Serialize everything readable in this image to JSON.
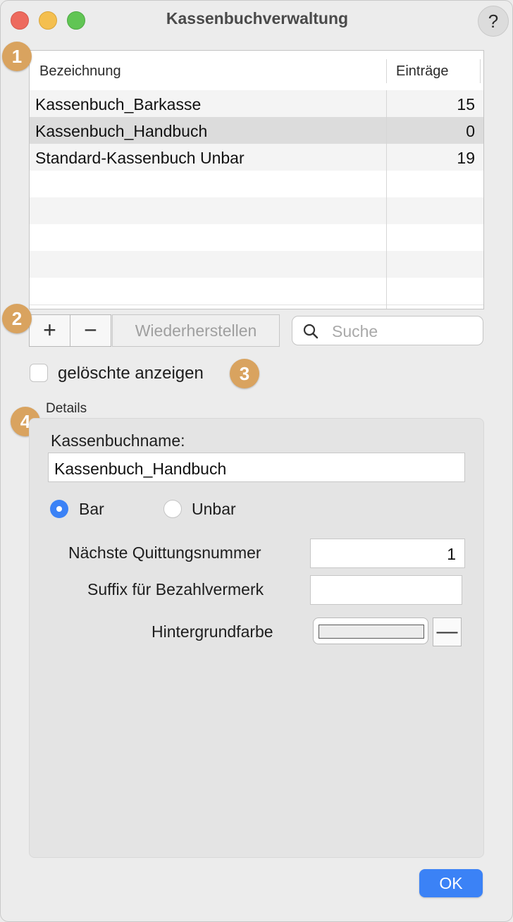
{
  "window": {
    "title": "Kassenbuchverwaltung",
    "help_label": "?"
  },
  "badges": [
    "1",
    "2",
    "3",
    "4"
  ],
  "table": {
    "columns": [
      "Bezeichnung",
      "Einträge"
    ],
    "rows": [
      {
        "name": "Kassenbuch_Barkasse",
        "count": "15",
        "selected": false
      },
      {
        "name": "Kassenbuch_Handbuch",
        "count": "0",
        "selected": true
      },
      {
        "name": "Standard-Kassenbuch Unbar",
        "count": "19",
        "selected": false
      }
    ],
    "empty_rows": 5
  },
  "toolbar": {
    "add_label": "+",
    "remove_label": "−",
    "restore_label": "Wiederherstellen"
  },
  "search": {
    "placeholder": "Suche",
    "value": ""
  },
  "show_deleted": {
    "label": "gelöschte anzeigen",
    "checked": false
  },
  "details": {
    "title": "Details",
    "name_label": "Kassenbuchname:",
    "name_value": "Kassenbuch_Handbuch",
    "radio_bar": "Bar",
    "radio_unbar": "Unbar",
    "selected_type": "Bar",
    "next_receipt_label": "Nächste Quittungsnummer",
    "next_receipt_value": "1",
    "suffix_label": "Suffix für Bezahlvermerk",
    "suffix_value": "",
    "bgcolor_label": "Hintergrundfarbe",
    "bgcolor_minus": "—",
    "bgcolor_value": "#ececec"
  },
  "ok_label": "OK",
  "colors": {
    "accent": "#3b82f6",
    "badge": "#d9a35f",
    "selected_row": "#dcdcdc",
    "striped_row": "#f4f4f4"
  }
}
